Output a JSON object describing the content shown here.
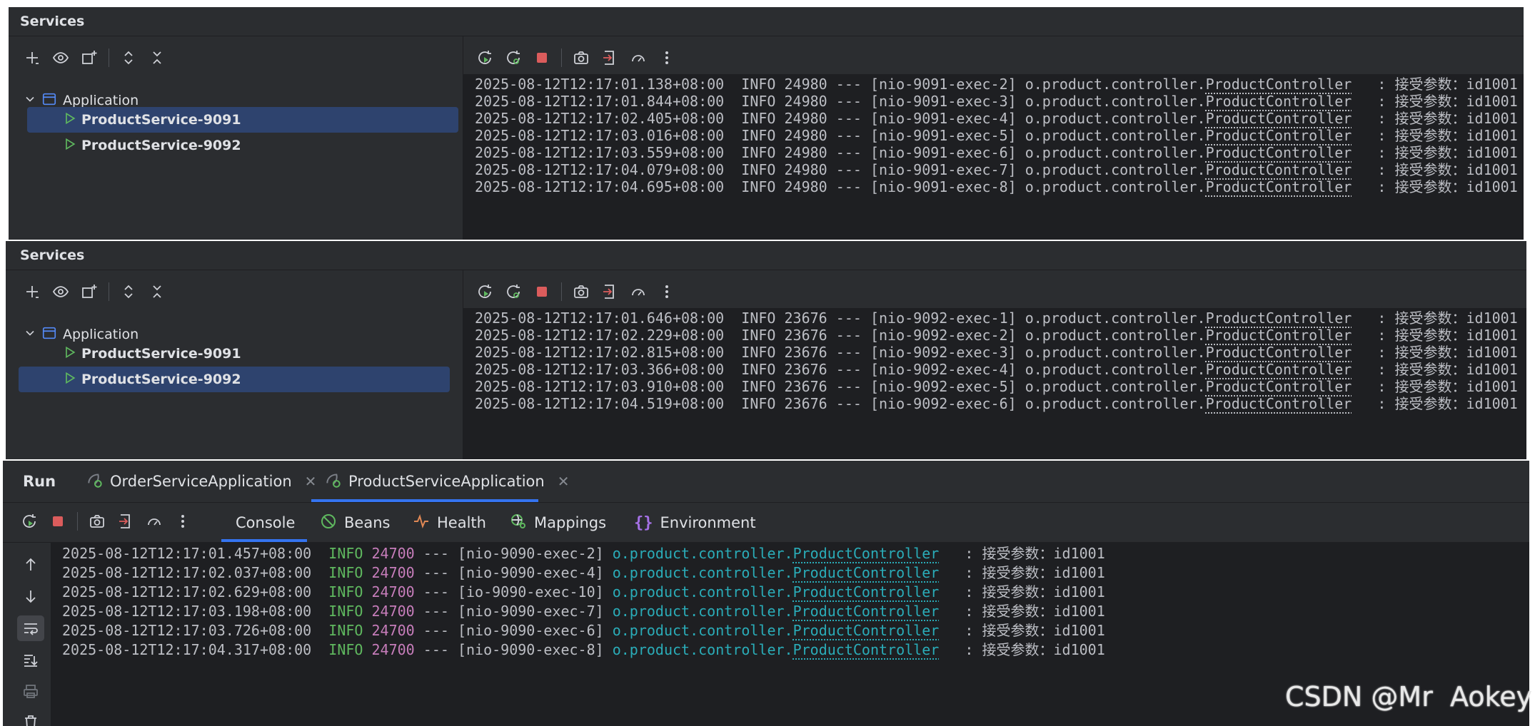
{
  "panels": [
    {
      "title": "Services",
      "tree": {
        "group": "Application",
        "items": [
          {
            "label": "ProductService-9091",
            "selected": true
          },
          {
            "label": "ProductService-9092",
            "selected": false
          }
        ]
      },
      "logs": [
        {
          "ts": "2025-08-12T12:17:01.138+08:00",
          "level": "INFO",
          "pid": "24980",
          "sep": "---",
          "thread": "[nio-9091-exec-2]",
          "pkg": "o.product.controller.",
          "cls": "ProductController",
          "colon": ":",
          "msg": "接受参数：id1001"
        },
        {
          "ts": "2025-08-12T12:17:01.844+08:00",
          "level": "INFO",
          "pid": "24980",
          "sep": "---",
          "thread": "[nio-9091-exec-3]",
          "pkg": "o.product.controller.",
          "cls": "ProductController",
          "colon": ":",
          "msg": "接受参数：id1001"
        },
        {
          "ts": "2025-08-12T12:17:02.405+08:00",
          "level": "INFO",
          "pid": "24980",
          "sep": "---",
          "thread": "[nio-9091-exec-4]",
          "pkg": "o.product.controller.",
          "cls": "ProductController",
          "colon": ":",
          "msg": "接受参数：id1001"
        },
        {
          "ts": "2025-08-12T12:17:03.016+08:00",
          "level": "INFO",
          "pid": "24980",
          "sep": "---",
          "thread": "[nio-9091-exec-5]",
          "pkg": "o.product.controller.",
          "cls": "ProductController",
          "colon": ":",
          "msg": "接受参数：id1001"
        },
        {
          "ts": "2025-08-12T12:17:03.559+08:00",
          "level": "INFO",
          "pid": "24980",
          "sep": "---",
          "thread": "[nio-9091-exec-6]",
          "pkg": "o.product.controller.",
          "cls": "ProductController",
          "colon": ":",
          "msg": "接受参数：id1001"
        },
        {
          "ts": "2025-08-12T12:17:04.079+08:00",
          "level": "INFO",
          "pid": "24980",
          "sep": "---",
          "thread": "[nio-9091-exec-7]",
          "pkg": "o.product.controller.",
          "cls": "ProductController",
          "colon": ":",
          "msg": "接受参数：id1001"
        },
        {
          "ts": "2025-08-12T12:17:04.695+08:00",
          "level": "INFO",
          "pid": "24980",
          "sep": "---",
          "thread": "[nio-9091-exec-8]",
          "pkg": "o.product.controller.",
          "cls": "ProductController",
          "colon": ":",
          "msg": "接受参数：id1001"
        }
      ]
    },
    {
      "title": "Services",
      "tree": {
        "group": "Application",
        "items": [
          {
            "label": "ProductService-9091",
            "selected": false
          },
          {
            "label": "ProductService-9092",
            "selected": true
          }
        ]
      },
      "logs": [
        {
          "ts": "2025-08-12T12:17:01.646+08:00",
          "level": "INFO",
          "pid": "23676",
          "sep": "---",
          "thread": "[nio-9092-exec-1]",
          "pkg": "o.product.controller.",
          "cls": "ProductController",
          "colon": ":",
          "msg": "接受参数：id1001"
        },
        {
          "ts": "2025-08-12T12:17:02.229+08:00",
          "level": "INFO",
          "pid": "23676",
          "sep": "---",
          "thread": "[nio-9092-exec-2]",
          "pkg": "o.product.controller.",
          "cls": "ProductController",
          "colon": ":",
          "msg": "接受参数：id1001"
        },
        {
          "ts": "2025-08-12T12:17:02.815+08:00",
          "level": "INFO",
          "pid": "23676",
          "sep": "---",
          "thread": "[nio-9092-exec-3]",
          "pkg": "o.product.controller.",
          "cls": "ProductController",
          "colon": ":",
          "msg": "接受参数：id1001"
        },
        {
          "ts": "2025-08-12T12:17:03.366+08:00",
          "level": "INFO",
          "pid": "23676",
          "sep": "---",
          "thread": "[nio-9092-exec-4]",
          "pkg": "o.product.controller.",
          "cls": "ProductController",
          "colon": ":",
          "msg": "接受参数：id1001"
        },
        {
          "ts": "2025-08-12T12:17:03.910+08:00",
          "level": "INFO",
          "pid": "23676",
          "sep": "---",
          "thread": "[nio-9092-exec-5]",
          "pkg": "o.product.controller.",
          "cls": "ProductController",
          "colon": ":",
          "msg": "接受参数：id1001"
        },
        {
          "ts": "2025-08-12T12:17:04.519+08:00",
          "level": "INFO",
          "pid": "23676",
          "sep": "---",
          "thread": "[nio-9092-exec-6]",
          "pkg": "o.product.controller.",
          "cls": "ProductController",
          "colon": ":",
          "msg": "接受参数：id1001"
        }
      ]
    }
  ],
  "run": {
    "title": "Run",
    "tabs": [
      {
        "label": "OrderServiceApplication",
        "active": false
      },
      {
        "label": "ProductServiceApplication",
        "active": true
      }
    ],
    "subtabs": [
      {
        "label": "Console",
        "icon": "none",
        "active": true
      },
      {
        "label": "Beans",
        "icon": "beans-icon"
      },
      {
        "label": "Health",
        "icon": "health-icon"
      },
      {
        "label": "Mappings",
        "icon": "mappings-icon"
      },
      {
        "label": "Environment",
        "icon": "environment-icon"
      }
    ],
    "logs": [
      {
        "ts": "2025-08-12T12:17:01.457+08:00",
        "level": "INFO",
        "pid": "24700",
        "sep": "---",
        "thread": "[nio-9090-exec-2]",
        "pkg": "o.product.controller.",
        "cls": "ProductController",
        "colon": ":",
        "msg": "接受参数：id1001"
      },
      {
        "ts": "2025-08-12T12:17:02.037+08:00",
        "level": "INFO",
        "pid": "24700",
        "sep": "---",
        "thread": "[nio-9090-exec-4]",
        "pkg": "o.product.controller.",
        "cls": "ProductController",
        "colon": ":",
        "msg": "接受参数：id1001"
      },
      {
        "ts": "2025-08-12T12:17:02.629+08:00",
        "level": "INFO",
        "pid": "24700",
        "sep": "---",
        "thread": "[io-9090-exec-10]",
        "pkg": "o.product.controller.",
        "cls": "ProductController",
        "colon": ":",
        "msg": "接受参数：id1001"
      },
      {
        "ts": "2025-08-12T12:17:03.198+08:00",
        "level": "INFO",
        "pid": "24700",
        "sep": "---",
        "thread": "[nio-9090-exec-7]",
        "pkg": "o.product.controller.",
        "cls": "ProductController",
        "colon": ":",
        "msg": "接受参数：id1001"
      },
      {
        "ts": "2025-08-12T12:17:03.726+08:00",
        "level": "INFO",
        "pid": "24700",
        "sep": "---",
        "thread": "[nio-9090-exec-6]",
        "pkg": "o.product.controller.",
        "cls": "ProductController",
        "colon": ":",
        "msg": "接受参数：id1001"
      },
      {
        "ts": "2025-08-12T12:17:04.317+08:00",
        "level": "INFO",
        "pid": "24700",
        "sep": "---",
        "thread": "[nio-9090-exec-8]",
        "pkg": "o.product.controller.",
        "cls": "ProductController",
        "colon": ":",
        "msg": "接受参数：id1001"
      }
    ]
  },
  "watermark": "CSDN @Mr  Aokey",
  "colors": {
    "panel_bg": "#2b2d30",
    "console_bg": "#1e1f22",
    "selection": "#2e436e",
    "run_green": "#5fb85f",
    "stop_red": "#db5c5c",
    "pid_purple": "#c77dbb",
    "logger_cyan": "#2aacb8",
    "tab_underline": "#3574f0"
  }
}
